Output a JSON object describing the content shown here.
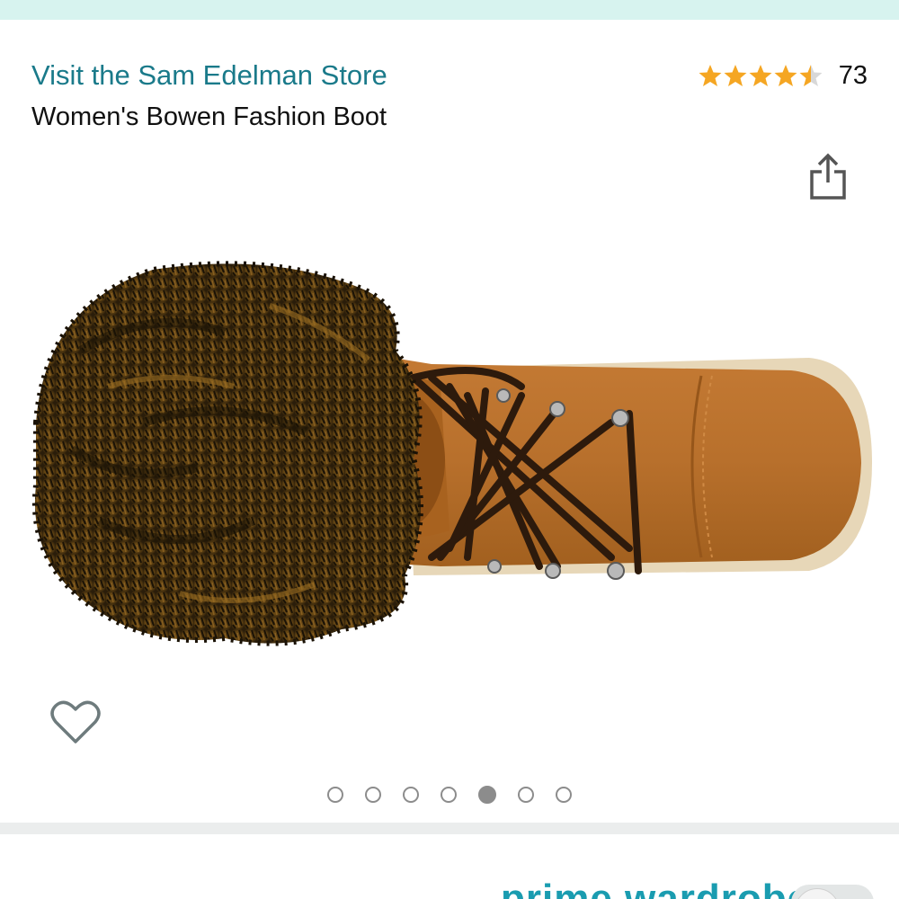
{
  "header": {
    "store_link": "Visit the Sam Edelman Store",
    "product_title": "Women's Bowen Fashion Boot"
  },
  "rating": {
    "stars": 4.5,
    "count": "73",
    "star_color": "#f5a623"
  },
  "icons": {
    "share": "share-icon",
    "wishlist": "heart-icon"
  },
  "carousel": {
    "total_images": 7,
    "active_index": 4
  },
  "footer": {
    "prime_wardrobe": "prime wardrobe"
  },
  "colors": {
    "top_bar": "#d7f3ef",
    "link": "#1a7a8a",
    "prime": "#1a9cb0"
  }
}
